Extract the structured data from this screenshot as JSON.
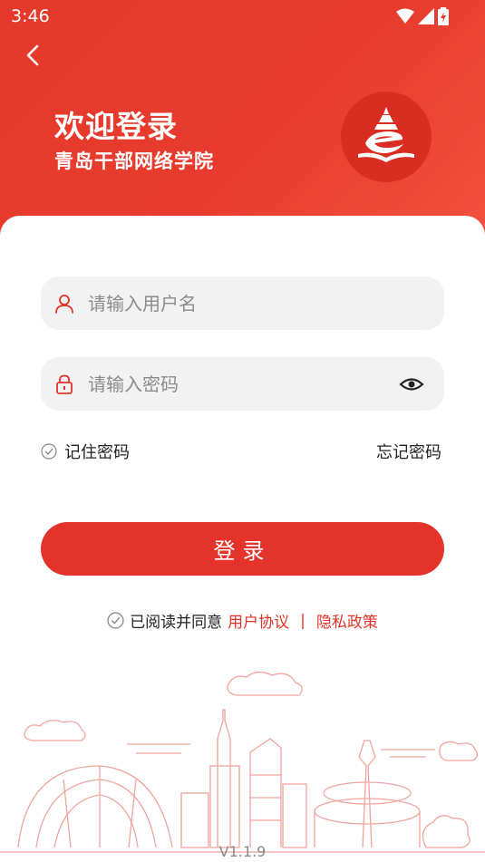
{
  "status_bar": {
    "time": "3:46"
  },
  "header": {
    "title": "欢迎登录",
    "subtitle": "青岛干部网络学院",
    "logo_icon": "academy-logo-icon"
  },
  "form": {
    "username_placeholder": "请输入用户名",
    "password_placeholder": "请输入密码",
    "remember_label": "记住密码",
    "forgot_label": "忘记密码",
    "login_label": "登录"
  },
  "agreement": {
    "prefix": "已阅读并同意",
    "user_agreement": "用户协议",
    "separator": "|",
    "privacy_policy": "隐私政策"
  },
  "version": "V1.1.9",
  "colors": {
    "accent": "#e3332a",
    "header_light": "#f2533f",
    "field_bg": "#f2f2f2"
  }
}
